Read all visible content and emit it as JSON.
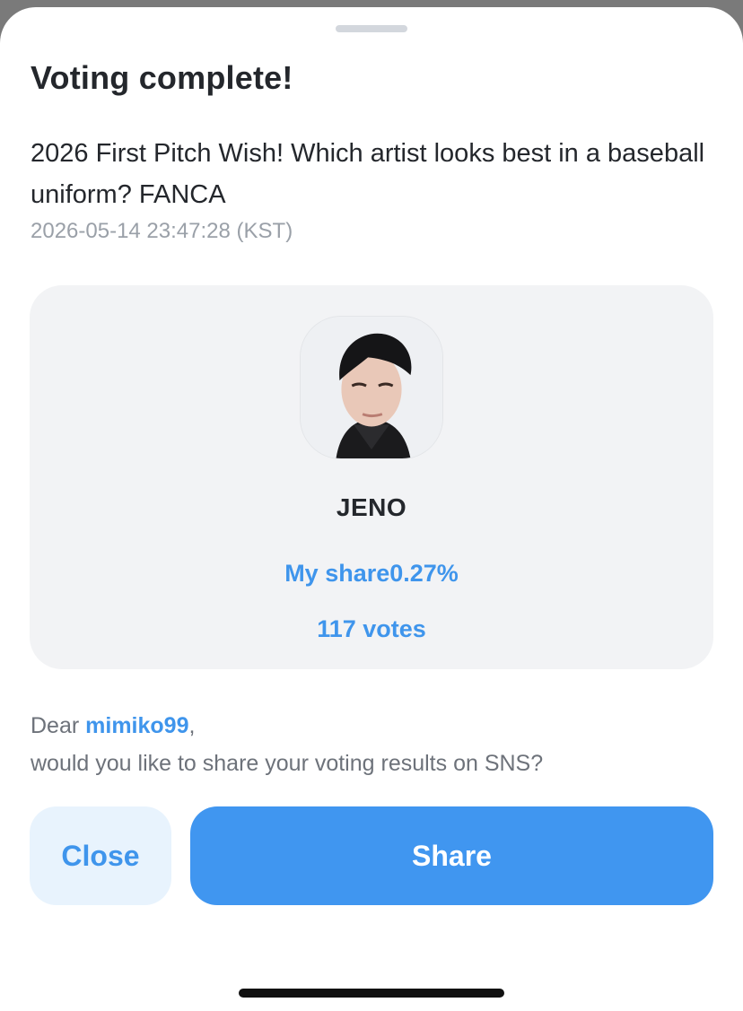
{
  "sheet": {
    "title": "Voting complete!",
    "question": "2026 First Pitch Wish! Which artist looks best in a baseball uniform? FANCA",
    "timestamp": "2026-05-14 23:47:28 (KST)"
  },
  "result_card": {
    "artist_name": "JENO",
    "my_share_label": "My share",
    "my_share_value": "0.27%",
    "votes": "117 votes"
  },
  "message": {
    "greeting": "Dear ",
    "username": "mimiko99",
    "comma": ",",
    "prompt": "would you like to share your voting results on SNS?"
  },
  "buttons": {
    "close_label": "Close",
    "share_label": "Share"
  },
  "colors": {
    "accent": "#4096f0",
    "accent_text": "#3f95ec",
    "card_bg": "#f2f3f5",
    "close_bg": "#e8f3fd"
  }
}
